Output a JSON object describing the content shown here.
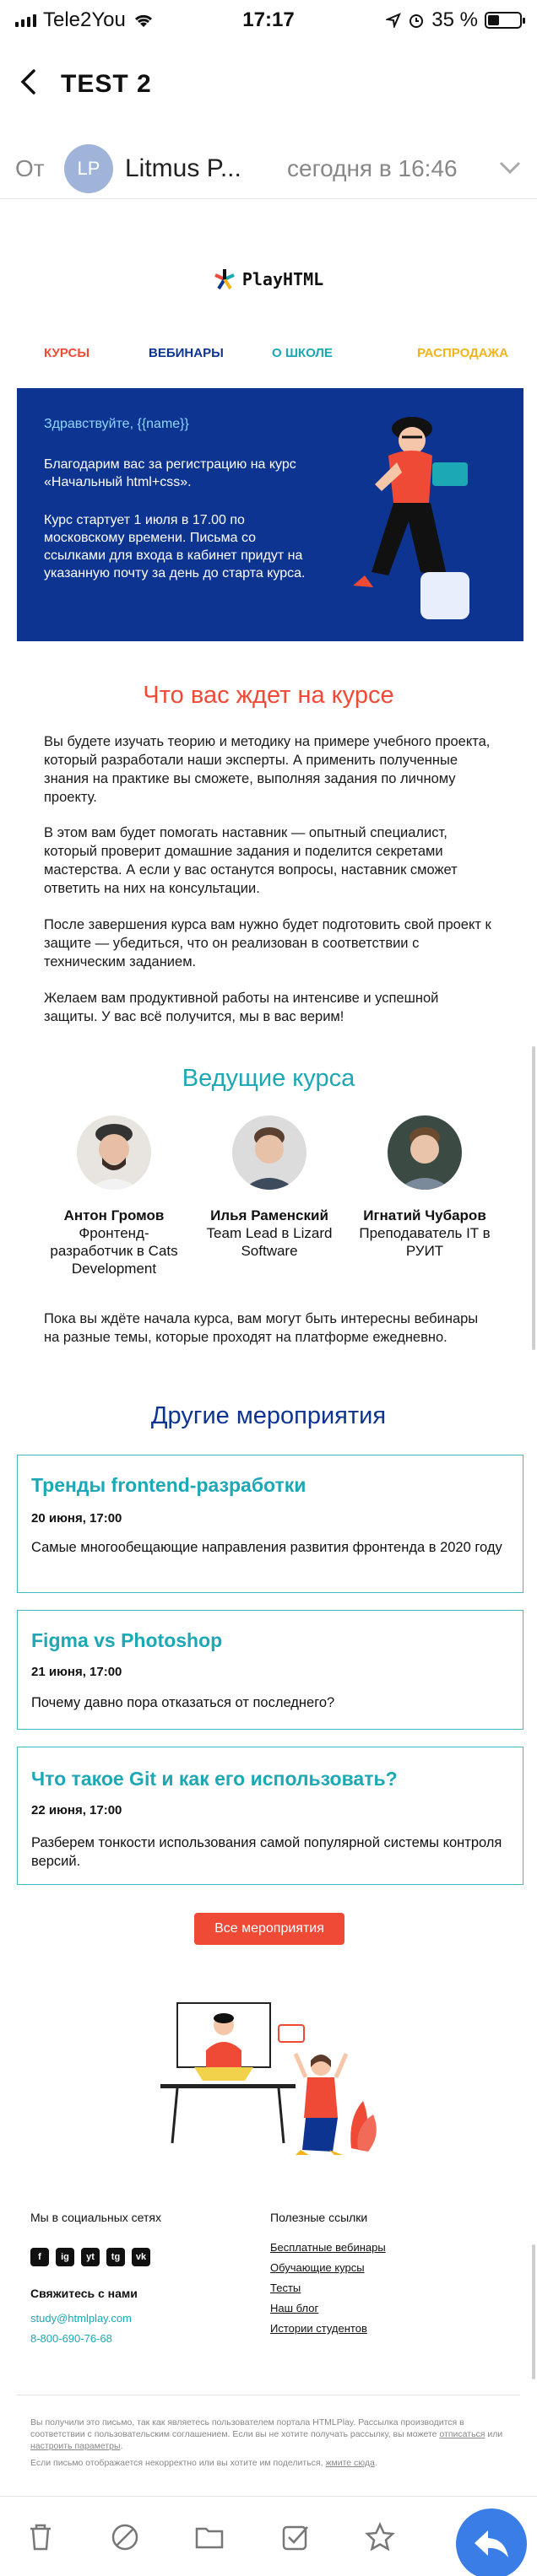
{
  "status_bar": {
    "carrier": "Tele2You",
    "time": "17:17",
    "battery_text": "35 %",
    "battery_level": 0.35
  },
  "mail": {
    "subject": "TEST 2",
    "from_label": "От",
    "sender_initials": "LP",
    "sender_name": "Litmus P...",
    "date": "сегодня в 16:46"
  },
  "email": {
    "logo": "PlayHTML",
    "nav": [
      {
        "label": "КУРСЫ",
        "color": "#ef4a36"
      },
      {
        "label": "ВЕБИНАРЫ",
        "color": "#0e3492"
      },
      {
        "label": "О ШКОЛЕ",
        "color": "#1da8b5"
      },
      {
        "label": "РАСПРОДАЖА",
        "color": "#f2b41b"
      }
    ],
    "hero": {
      "greeting": "Здравствуйте, {{name}}",
      "p1": "Благодарим вас за регистрацию на курс «Начальный html+css».",
      "p2": "Курс стартует 1 июля в 17.00 по московскому времени. Письма со ссылками для входа в кабинет придут на указанную почту за день до старта курса."
    },
    "course": {
      "title": "Что вас ждет на курсе",
      "paragraphs": [
        "Вы будете изучать теорию и методику на примере учебного проекта, который разработали наши эксперты. А применить полученные знания на практике вы сможете, выполняя задания по личному проекту.",
        "В этом вам будет помогать наставник — опытный специалист, который проверит домашние задания и поделится секретами мастерства. А если у вас останутся вопросы, наставник сможет ответить на них на консультации.",
        "После завершения курса вам нужно будет подготовить свой проект к защите — убедиться, что он реализован в соответствии с техническим заданием.",
        "Желаем вам продуктивной работы на интенсиве и успешной защиты. У вас всё получится, мы в вас верим!"
      ]
    },
    "teachers": {
      "title": "Ведущие курса",
      "items": [
        {
          "name": "Антон Громов",
          "role": "Фронтенд-разработчик в Cats Development"
        },
        {
          "name": "Илья Раменский",
          "role": "Team Lead в Lizard Software"
        },
        {
          "name": "Игнатий Чубаров",
          "role": "Преподаватель IT в РУИТ"
        }
      ]
    },
    "webinars_intro": "Пока вы ждёте начала курса, вам могут быть интересны вебинары на разные темы, которые проходят на платформе ежедневно.",
    "events": {
      "title": "Другие мероприятия",
      "items": [
        {
          "title": "Тренды frontend-разработки",
          "date": "20 июня, 17:00",
          "desc": "Самые многообещающие направления развития фронтенда в 2020 году"
        },
        {
          "title": "Figma vs Photoshop",
          "date": "21 июня, 17:00",
          "desc": "Почему давно пора отказаться от последнего?"
        },
        {
          "title": "Что такое Git и как его использовать?",
          "date": "22 июня, 17:00",
          "desc": "Разберем тонкости использования самой популярной системы контроля версий."
        }
      ],
      "all_button": "Все мероприятия"
    },
    "footer": {
      "social_heading": "Мы в социальных сетях",
      "social_icons": [
        "f",
        "ig",
        "yt",
        "tg",
        "vk"
      ],
      "contact_heading": "Свяжитесь с нами",
      "email": "study@htmlplay.com",
      "phone": "8-800-690-76-68",
      "links_heading": "Полезные ссылки",
      "links": [
        "Бесплатные вебинары",
        "Обучающие курсы",
        "Тесты",
        "Наш блог",
        "Истории студентов"
      ],
      "legal1": "Вы получили это письмо, так как являетесь пользователем портала HTMLPlay. Рассылка производится в соответствии с пользовательским соглашением. Если вы не хотите получать рассылку, вы можете",
      "legal_unsub": "отписаться",
      "legal_or": "или",
      "legal_settings": "настроить параметры",
      "legal2": "Если письмо отображается некорректно или вы хотите им поделиться,",
      "legal_web": "жмите сюда"
    }
  },
  "colors": {
    "brand_blue": "#0e3492",
    "accent_red": "#ef4a36",
    "accent_teal": "#1da8b5",
    "link_teal": "#1da8b5"
  }
}
